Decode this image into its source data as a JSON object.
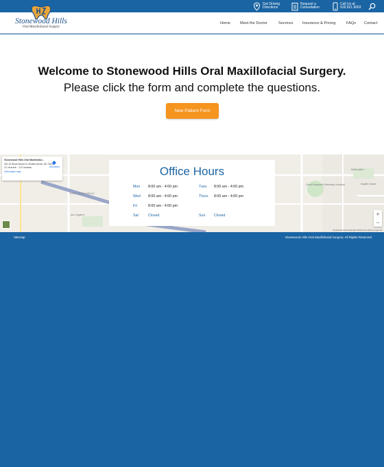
{
  "topbar": {
    "directions": {
      "line1": "Get Driving",
      "line2": "Directions"
    },
    "consult": {
      "line1": "Request a",
      "line2": "Consultation"
    },
    "call": {
      "line1": "Call Us at",
      "line2": "918.921.9003"
    }
  },
  "logo": {
    "name": "Stonewood Hills",
    "tagline": "Oral Maxillofacial Surgery"
  },
  "nav": [
    "Home",
    "Meet the Doctor",
    "Services",
    "Insurance & Pricing",
    "FAQs",
    "Contact"
  ],
  "hero": {
    "title": "Welcome to Stonewood Hills Oral Maxillofacial Surgery.",
    "subtitle": "Please click the form and complete the questions.",
    "button": "New Patient Form"
  },
  "map": {
    "card_title": "Stonewood Hills Oral Maxillofaci...",
    "card_address": "421 W Stone Wood Dr, Broken Arrow, OK 74012",
    "card_rating": "4.2 ★★★★☆  137 reviews",
    "card_link": "View larger map",
    "directions": "Directions",
    "footer": "Keyboard shortcuts   Map data ©2024   Terms   Report a map error"
  },
  "hours": {
    "title": "Office Hours",
    "rows": [
      {
        "day": "Mon",
        "time": "8:00 am - 4:00 pm"
      },
      {
        "day": "Tues",
        "time": "8:00 am - 4:00 pm"
      },
      {
        "day": "Wed",
        "time": "8:00 am - 4:00 pm"
      },
      {
        "day": "Thurs",
        "time": "8:00 am - 4:00 pm"
      },
      {
        "day": "Fri",
        "time": "8:00 am - 4:00 pm"
      },
      {
        "day": "Sat",
        "time": "Closed"
      },
      {
        "day": "Sun",
        "time": "Closed"
      }
    ]
  },
  "footer": {
    "sitemap": "Sitemap",
    "copyright": "Stonewood Hills Oral Maxillofacial Surgery. All Rights Reserved"
  },
  "colors": {
    "brand_blue": "#1a64a3",
    "accent_orange": "#f5941f"
  }
}
